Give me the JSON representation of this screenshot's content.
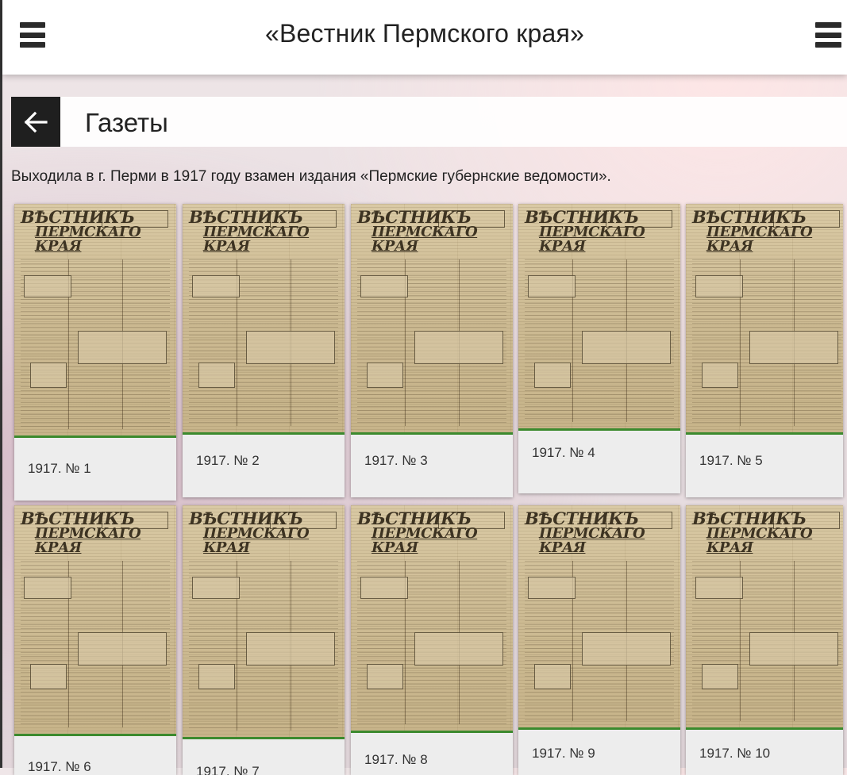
{
  "header": {
    "title": "«Вестник Пермского края»",
    "left_menu_icon": "menu-icon",
    "right_menu_icon": "menu-icon"
  },
  "section": {
    "back_icon": "arrow-left-icon",
    "title": "Газеты"
  },
  "description": "Выходила в г. Перми в 1917 году взамен издания «Пермские губернские ведомости».",
  "newspaper_mast": {
    "line1": "ВѢСТНИКЪ",
    "line2": "ПЕРМСКАГО КРАЯ"
  },
  "issues": [
    {
      "label": "1917. № 1"
    },
    {
      "label": "1917. № 2"
    },
    {
      "label": "1917. № 3"
    },
    {
      "label": "1917. № 4"
    },
    {
      "label": "1917. № 5"
    },
    {
      "label": "1917. № 6"
    },
    {
      "label": "1917. № 7"
    },
    {
      "label": "1917. № 8"
    },
    {
      "label": "1917. № 9"
    },
    {
      "label": "1917. № 10"
    }
  ],
  "colors": {
    "accent_border": "#3c8a2e",
    "header_bg": "#ffffff",
    "back_button_bg": "#1f1f1f"
  }
}
